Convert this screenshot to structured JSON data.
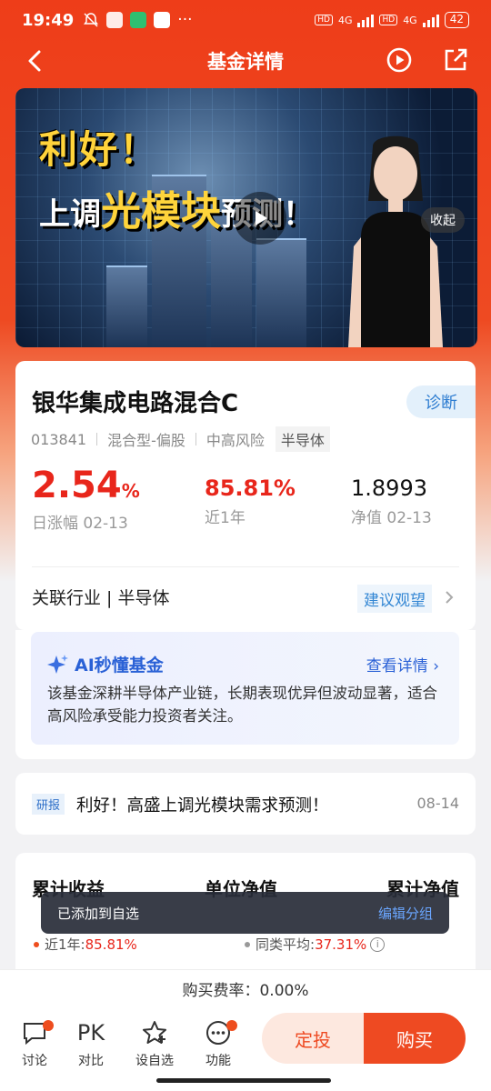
{
  "status_bar": {
    "time": "19:49",
    "network1": "4G",
    "network2": "4G",
    "battery": "42"
  },
  "nav": {
    "title": "基金详情"
  },
  "video": {
    "headline_line1": "利好！",
    "headline_line2_prefix": "上调",
    "headline_line2_highlight": "光模块",
    "headline_line2_suffix": "预测！",
    "collapse_label": "收起"
  },
  "fund": {
    "name": "银华集成电路混合C",
    "diagnose_label": "诊断",
    "code": "013841",
    "type": "混合型-偏股",
    "risk": "中高风险",
    "sector_tag": "半导体",
    "daily_change_value": "2.54",
    "daily_change_unit": "%",
    "daily_change_label": "日涨幅 02-13",
    "year_return": "85.81%",
    "year_return_label": "近1年",
    "nav_value": "1.8993",
    "nav_label": "净值 02-13",
    "industry": "关联行业 | 半导体",
    "advice": "建议观望"
  },
  "ai": {
    "title": "AI秒懂基金",
    "detail_link": "查看详情",
    "text": "该基金深耕半导体产业链，长期表现优异但波动显著，适合高风险承受能力投资者关注。"
  },
  "research": {
    "tag": "研报",
    "title": "利好！高盛上调光模块需求预测！",
    "date": "08-14"
  },
  "cumulative": {
    "headers": [
      "累计收益",
      "单位净值",
      "累计净值"
    ],
    "own_label": "近1年:",
    "own_value": "85.81%",
    "peer_label": "同类平均:",
    "peer_value": "37.31%",
    "own_color": "#ee4d1e",
    "peer_color": "#999999"
  },
  "toast": {
    "message": "已添加到自选",
    "action": "编辑分组"
  },
  "fee": {
    "text": "购买费率：0.00%"
  },
  "bottom_bar": {
    "tools": [
      {
        "label": "讨论",
        "icon": "chat-icon"
      },
      {
        "label": "对比",
        "icon_text": "PK"
      },
      {
        "label": "设自选",
        "icon": "star-icon"
      },
      {
        "label": "功能",
        "icon": "more-icon"
      }
    ],
    "fixed_invest": "定投",
    "buy": "购买"
  },
  "colors": {
    "brand": "#ee4a22",
    "up_red": "#e8261b",
    "link_blue": "#2a61d6"
  }
}
